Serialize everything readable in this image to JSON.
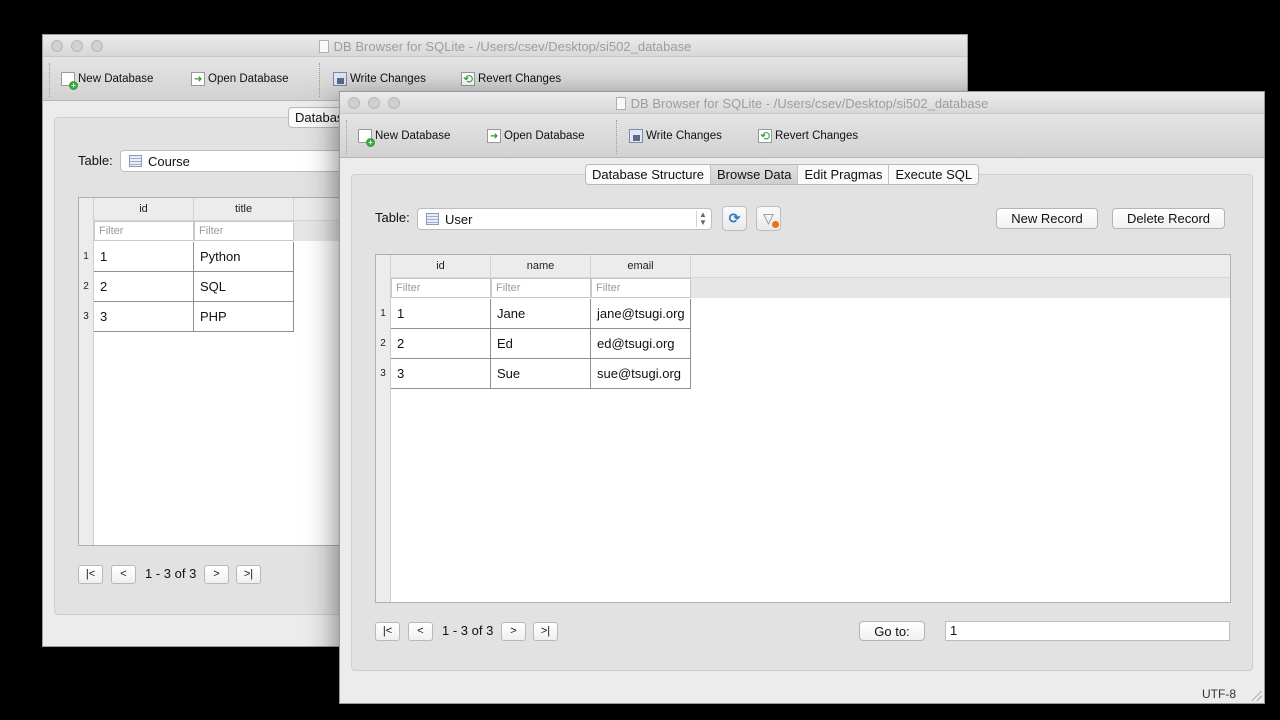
{
  "back_window": {
    "title": "DB Browser for SQLite - /Users/csev/Desktop/si502_database",
    "toolbar": {
      "new_database": "New Database",
      "open_database": "Open Database",
      "write_changes": "Write Changes",
      "revert_changes": "Revert Changes"
    },
    "tab_visible": "Databas",
    "table_label": "Table:",
    "table_selected": "Course",
    "columns": [
      "id",
      "title"
    ],
    "filter_placeholder": "Filter",
    "rows": [
      {
        "num": "1",
        "cells": [
          "1",
          "Python"
        ]
      },
      {
        "num": "2",
        "cells": [
          "2",
          "SQL"
        ]
      },
      {
        "num": "3",
        "cells": [
          "3",
          "PHP"
        ]
      }
    ],
    "nav": {
      "first": "|<",
      "prev": "<",
      "next": ">",
      "last": ">|",
      "info": "1 - 3 of 3"
    }
  },
  "front_window": {
    "title": "DB Browser for SQLite - /Users/csev/Desktop/si502_database",
    "toolbar": {
      "new_database": "New Database",
      "open_database": "Open Database",
      "write_changes": "Write Changes",
      "revert_changes": "Revert Changes"
    },
    "tabs": [
      {
        "label": "Database Structure",
        "active": false
      },
      {
        "label": "Browse Data",
        "active": true
      },
      {
        "label": "Edit Pragmas",
        "active": false
      },
      {
        "label": "Execute SQL",
        "active": false
      }
    ],
    "table_label": "Table:",
    "table_selected": "User",
    "new_record": "New Record",
    "delete_record": "Delete Record",
    "columns": [
      "id",
      "name",
      "email"
    ],
    "filter_placeholder": "Filter",
    "rows": [
      {
        "num": "1",
        "cells": [
          "1",
          "Jane",
          "jane@tsugi.org"
        ]
      },
      {
        "num": "2",
        "cells": [
          "2",
          "Ed",
          "ed@tsugi.org"
        ]
      },
      {
        "num": "3",
        "cells": [
          "3",
          "Sue",
          "sue@tsugi.org"
        ]
      }
    ],
    "nav": {
      "first": "|<",
      "prev": "<",
      "next": ">",
      "last": ">|",
      "info": "1 - 3 of 3"
    },
    "goto_label": "Go to:",
    "goto_value": "1",
    "encoding": "UTF-8"
  },
  "icons": {
    "new_database": "new-database-icon",
    "open_database": "open-database-icon",
    "write_changes": "write-changes-icon",
    "revert_changes": "revert-changes-icon",
    "refresh": "refresh-icon",
    "clear_filters": "clear-filters-icon",
    "table": "table-icon"
  }
}
